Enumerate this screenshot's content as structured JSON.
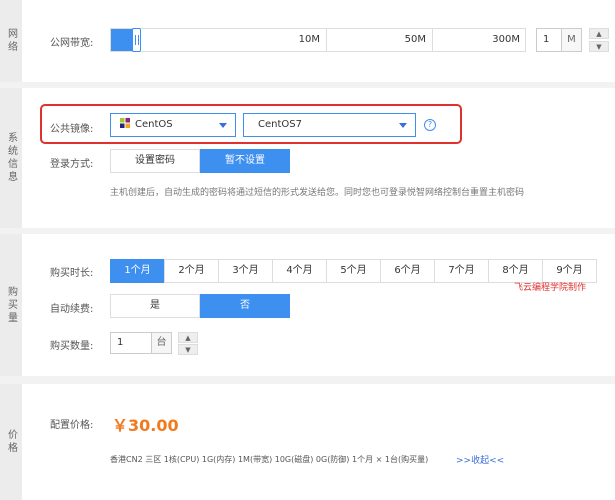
{
  "network": {
    "section_label": "网络",
    "bandwidth_label": "公网带宽:",
    "ticks": [
      "10M",
      "50M",
      "300M"
    ],
    "bandwidth_value": "1",
    "unit": "M",
    "spin_up": "▲",
    "spin_down": "▼"
  },
  "system": {
    "section_label": "系统信息",
    "image_label": "公共镜像:",
    "os_family": "CentOS",
    "os_version": "CentOS7",
    "help_icon": "?",
    "login_label": "登录方式:",
    "login_options": [
      "设置密码",
      "暂不设置"
    ],
    "hint": "主机创建后，自动生成的密码将通过短信的形式发送给您。同时您也可登录悦智网络控制台重置主机密码"
  },
  "purchase": {
    "section_label": "购买量",
    "duration_label": "购买时长:",
    "durations": [
      "1个月",
      "2个月",
      "3个月",
      "4个月",
      "5个月",
      "6个月",
      "7个月",
      "8个月",
      "9个月"
    ],
    "watermark": "飞云编程学院制作",
    "renew_label": "自动续费:",
    "renew_options": [
      "是",
      "否"
    ],
    "qty_label": "购买数量:",
    "qty_value": "1",
    "qty_unit": "台",
    "spin_up": "▲",
    "spin_down": "▼"
  },
  "price": {
    "section_label": "价格",
    "label": "配置价格:",
    "amount": "￥30.00",
    "summary": "香港CN2 三区  1核(CPU)  1G(内存)  1M(带宽)  10G(磁盘)  0G(防御)  1个月 × 1台(购买量)",
    "collapse": ">>收起<<"
  },
  "colors": {
    "accent": "#3d8ff0",
    "highlight": "#e0312f",
    "price": "#f07a1d"
  }
}
